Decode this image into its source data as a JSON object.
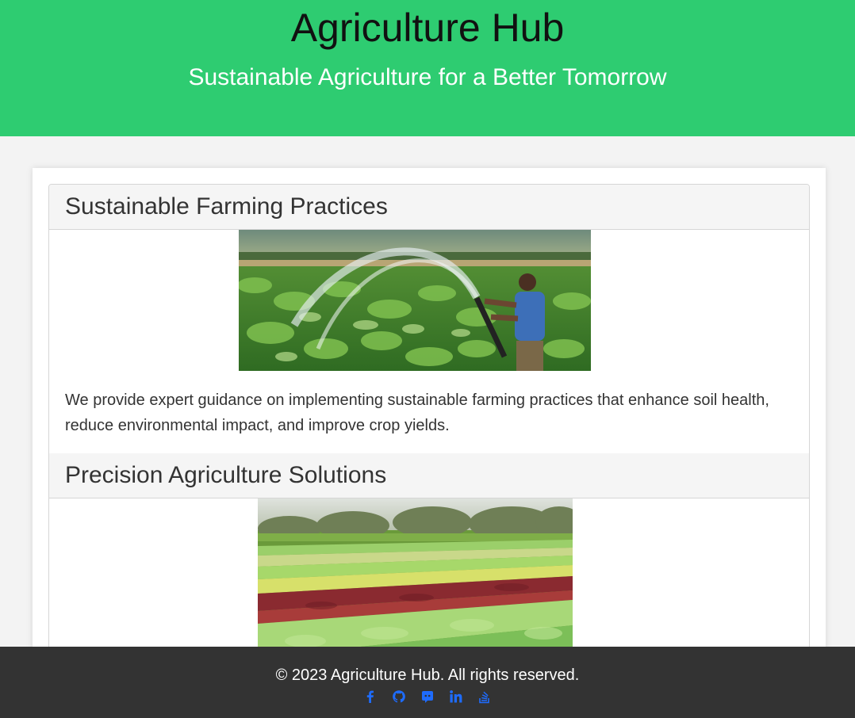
{
  "header": {
    "title": "Agriculture Hub",
    "subtitle": "Sustainable Agriculture for a Better Tomorrow"
  },
  "sections": [
    {
      "heading": "Sustainable Farming Practices",
      "description": "We provide expert guidance on implementing sustainable farming practices that enhance soil health, reduce environmental impact, and improve crop yields.",
      "image": "farmer-irrigating-field-photo"
    },
    {
      "heading": "Precision Agriculture Solutions",
      "image": "crop-rows-field-photo"
    }
  ],
  "footer": {
    "copyright": "© 2023 Agriculture Hub. All rights reserved.",
    "social_icons": [
      "facebook-icon",
      "github-icon",
      "discord-icon",
      "linkedin-icon",
      "stackoverflow-icon"
    ]
  },
  "colors": {
    "header_bg": "#2ecc71",
    "footer_bg": "#333333",
    "link": "#1e6cff"
  }
}
